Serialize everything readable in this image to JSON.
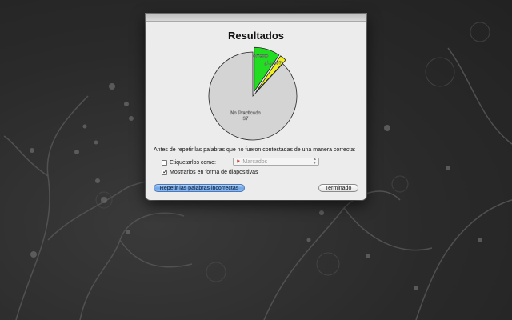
{
  "dialog": {
    "title": "Resultados",
    "prompt": "Antes de repetir las palabras que no fueron contestadas de una manera correcta:",
    "option_tag": {
      "label": "Etiquetarlos como:",
      "checked": false
    },
    "tag_select": {
      "value": "Marcados",
      "enabled": false
    },
    "option_slideshow": {
      "label": "Mostrarlos en forma de diapositivas",
      "checked": true
    },
    "repeat_button": "Repetir las palabras incorrectas",
    "done_button": "Terminado"
  },
  "chart_data": {
    "type": "pie",
    "slices": [
      {
        "label": "Correcto",
        "value_label": "",
        "value": 4,
        "color": "#22dd22"
      },
      {
        "label": "¿Lo sé?",
        "value_label": "",
        "value": 1,
        "color": "#f0f020"
      },
      {
        "label": "No Practicado",
        "value_label": "37",
        "value": 37,
        "color": "#d4d4d4"
      }
    ],
    "exploded": true
  }
}
